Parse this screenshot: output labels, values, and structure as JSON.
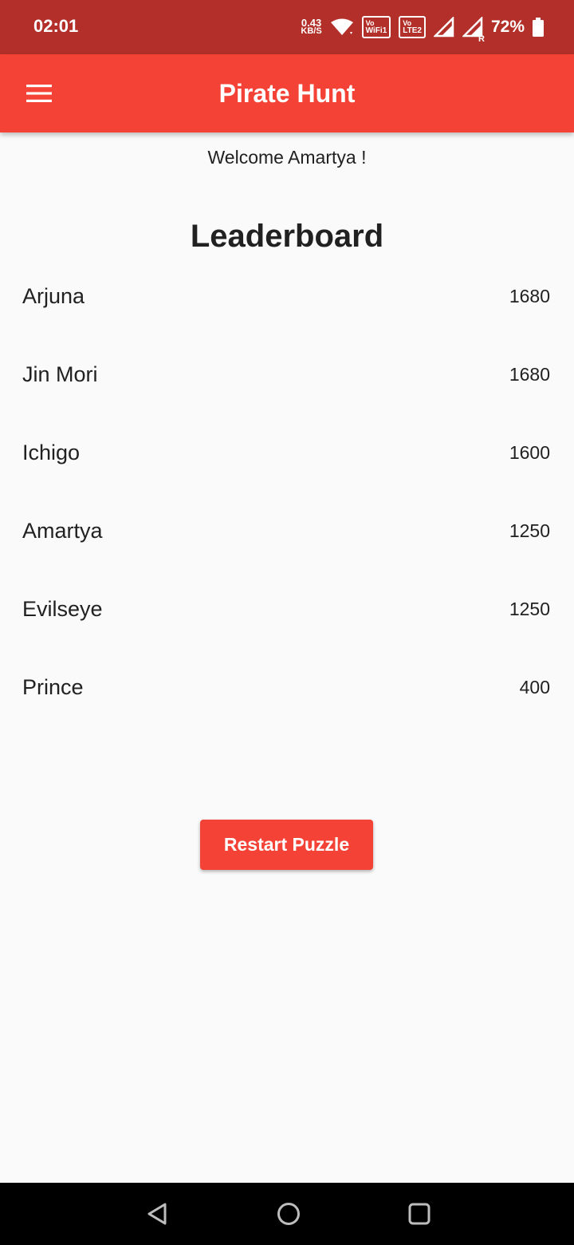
{
  "status_bar": {
    "time": "02:01",
    "net_speed_value": "0.43",
    "net_speed_unit": "KB/S",
    "wifi_badge_top": "Vo",
    "wifi_badge_bottom": "WiFi1",
    "lte_badge_top": "Vo",
    "lte_badge_bottom": "LTE2",
    "roaming_label": "R",
    "battery_percent": "72%"
  },
  "app_bar": {
    "title": "Pirate Hunt",
    "menu_icon": "hamburger-menu-icon"
  },
  "welcome_text": "Welcome Amartya !",
  "leaderboard": {
    "title": "Leaderboard",
    "entries": [
      {
        "name": "Arjuna",
        "score": "1680"
      },
      {
        "name": "Jin Mori",
        "score": "1680"
      },
      {
        "name": "Ichigo",
        "score": "1600"
      },
      {
        "name": "Amartya",
        "score": "1250"
      },
      {
        "name": "Evilseye",
        "score": "1250"
      },
      {
        "name": "Prince",
        "score": "400"
      }
    ]
  },
  "restart_button_label": "Restart Puzzle",
  "nav_bar": {
    "back_icon": "back-triangle-icon",
    "home_icon": "home-circle-icon",
    "recents_icon": "recents-square-icon"
  },
  "colors": {
    "status_bar": "#b3302a",
    "app_bar": "#f44336",
    "accent_button": "#f44336",
    "background": "#fafafa",
    "nav_bar": "#000000"
  }
}
